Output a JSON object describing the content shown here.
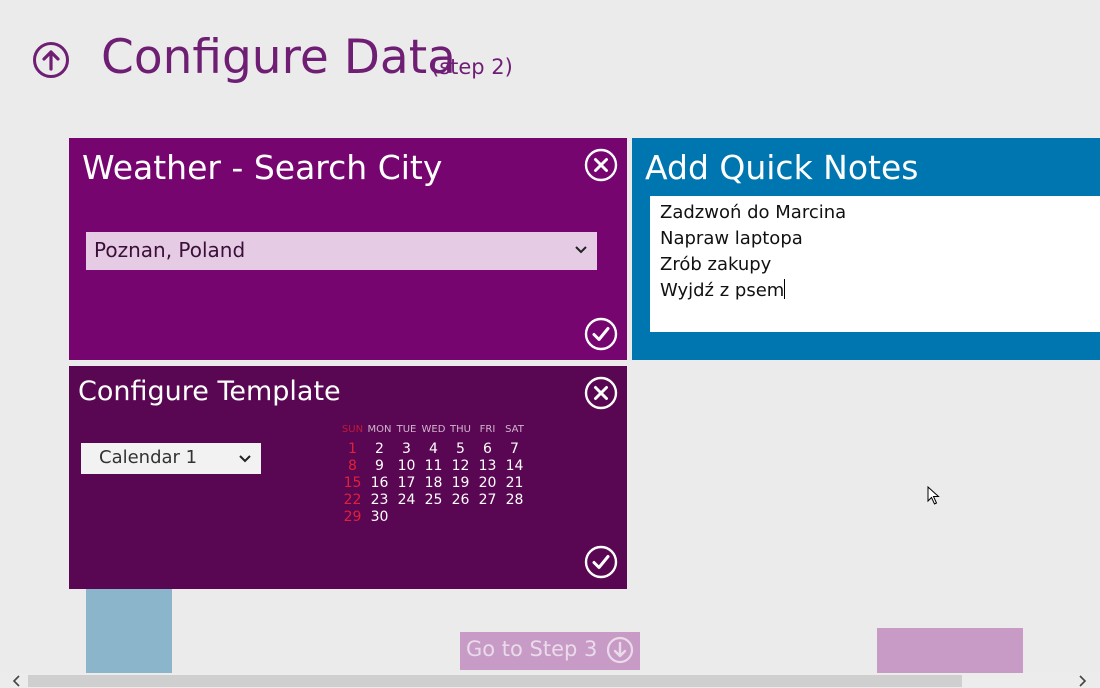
{
  "page": {
    "title": "Configure Data",
    "step": "(step 2)"
  },
  "weather_tile": {
    "title": "Weather - Search City",
    "city": "Poznan, Poland"
  },
  "notes_tile": {
    "title": "Add Quick Notes",
    "lines": [
      "Zadzwoń do Marcina",
      "Napraw laptopa",
      "Zrób zakupy",
      "Wyjdź z psem"
    ]
  },
  "template_tile": {
    "title": "Configure Template",
    "template": "Calendar 1",
    "calendar": {
      "days": [
        "SUN",
        "MON",
        "TUE",
        "WED",
        "THU",
        "FRI",
        "SAT"
      ],
      "weeks": [
        [
          "1",
          "2",
          "3",
          "4",
          "5",
          "6",
          "7"
        ],
        [
          "8",
          "9",
          "10",
          "11",
          "12",
          "13",
          "14"
        ],
        [
          "15",
          "16",
          "17",
          "18",
          "19",
          "20",
          "21"
        ],
        [
          "22",
          "23",
          "24",
          "25",
          "26",
          "27",
          "28"
        ],
        [
          "29",
          "30",
          "",
          "",
          "",
          "",
          ""
        ]
      ]
    }
  },
  "footer": {
    "next_button": "Go to Step 3"
  },
  "colors": {
    "accent": "#6f1f73",
    "weather_tile": "#770570",
    "notes_tile": "#0076b1",
    "template_tile": "#590752",
    "sunday": "#e0203a"
  },
  "icons": {
    "back": "arrow-up-circle-icon",
    "close": "close-circle-icon",
    "confirm": "check-circle-icon",
    "dropdown": "chevron-down-icon",
    "next": "arrow-down-circle-icon"
  }
}
